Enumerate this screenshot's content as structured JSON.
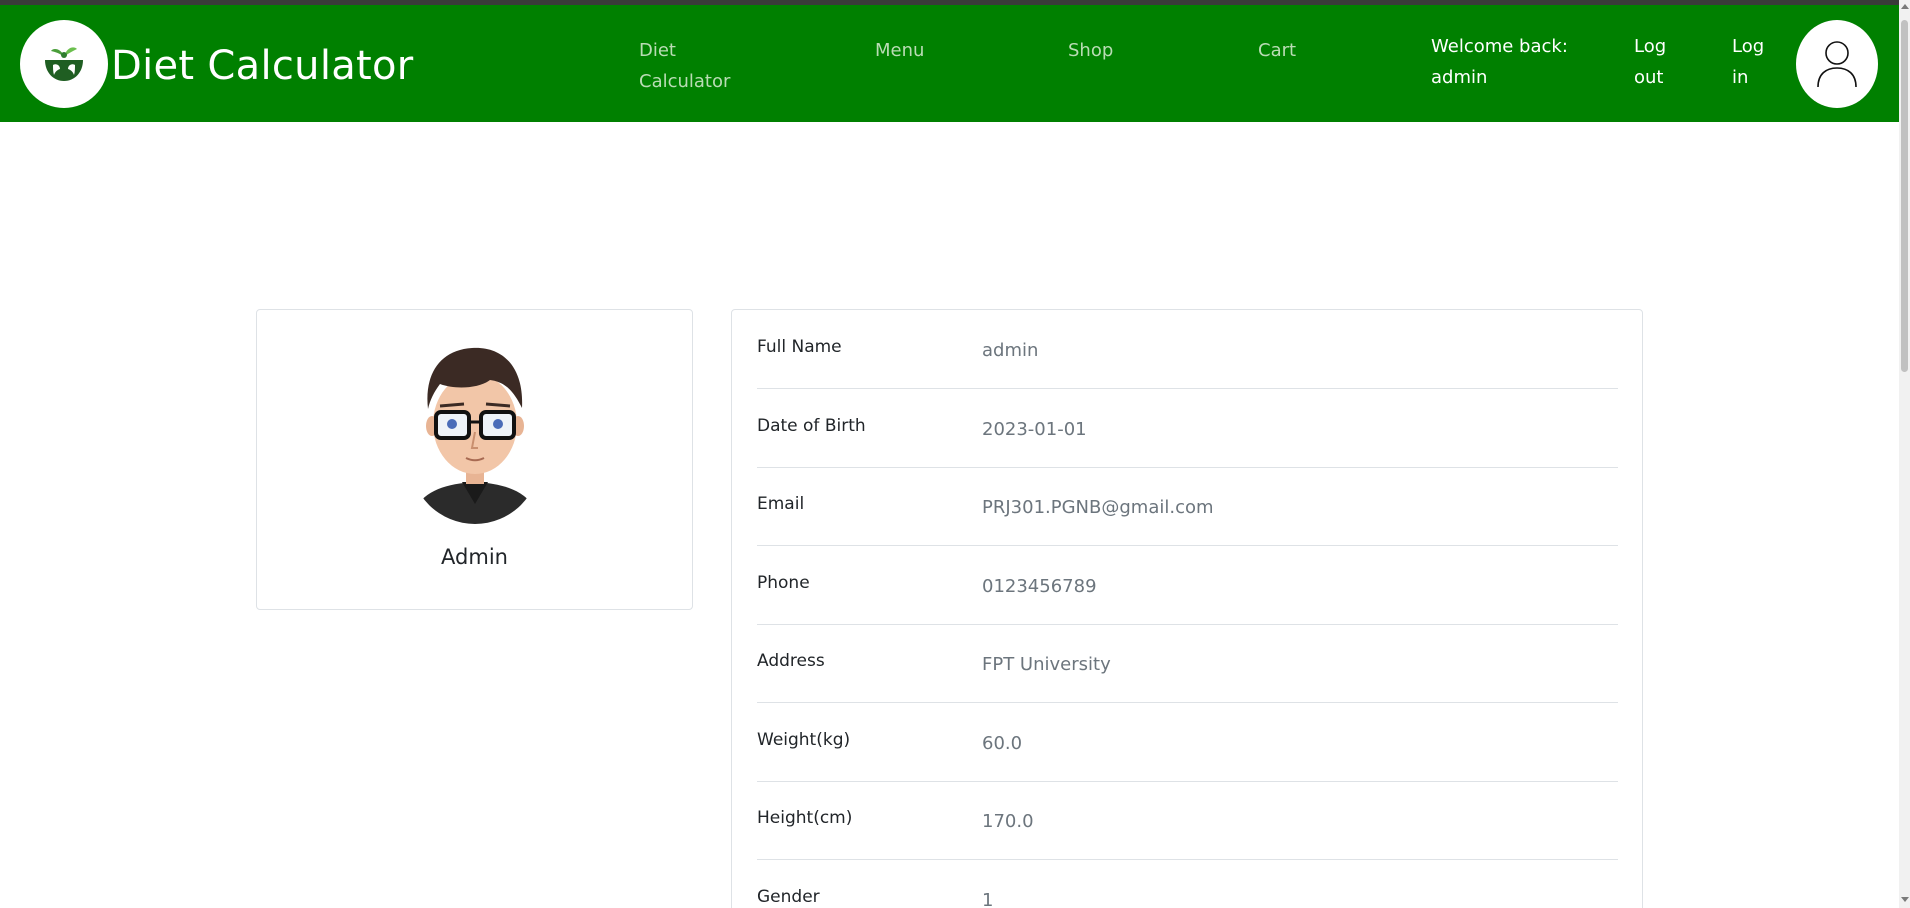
{
  "app": {
    "title": "Diet Calculator"
  },
  "colors": {
    "navbar": "#008000",
    "nav_link_muted": "#b9dcb4",
    "border": "#dee2e6",
    "value_text": "#6c757d"
  },
  "navbar": {
    "brand": "Diet Calculator",
    "links": [
      {
        "line1": "Diet",
        "line2": "Calculator"
      },
      {
        "line1": "Menu"
      },
      {
        "line1": "Shop"
      },
      {
        "line1": "Cart"
      }
    ],
    "welcome": {
      "line1": "Welcome back:",
      "line2": "admin"
    },
    "logout": {
      "line1": "Log",
      "line2": "out"
    },
    "login": {
      "line1": "Log",
      "line2": "in"
    },
    "icons": {
      "logo": "bowl-leaf-logo-icon",
      "user": "user-icon"
    }
  },
  "profile": {
    "name": "Admin",
    "avatar": "avatar-illustration"
  },
  "details": [
    {
      "label": "Full Name",
      "value": "admin"
    },
    {
      "label": "Date of Birth",
      "value": "2023-01-01"
    },
    {
      "label": "Email",
      "value": "PRJ301.PGNB@gmail.com"
    },
    {
      "label": "Phone",
      "value": "0123456789"
    },
    {
      "label": "Address",
      "value": "FPT University"
    },
    {
      "label": "Weight(kg)",
      "value": "60.0"
    },
    {
      "label": "Height(cm)",
      "value": "170.0"
    },
    {
      "label": "Gender",
      "value": "1"
    }
  ]
}
